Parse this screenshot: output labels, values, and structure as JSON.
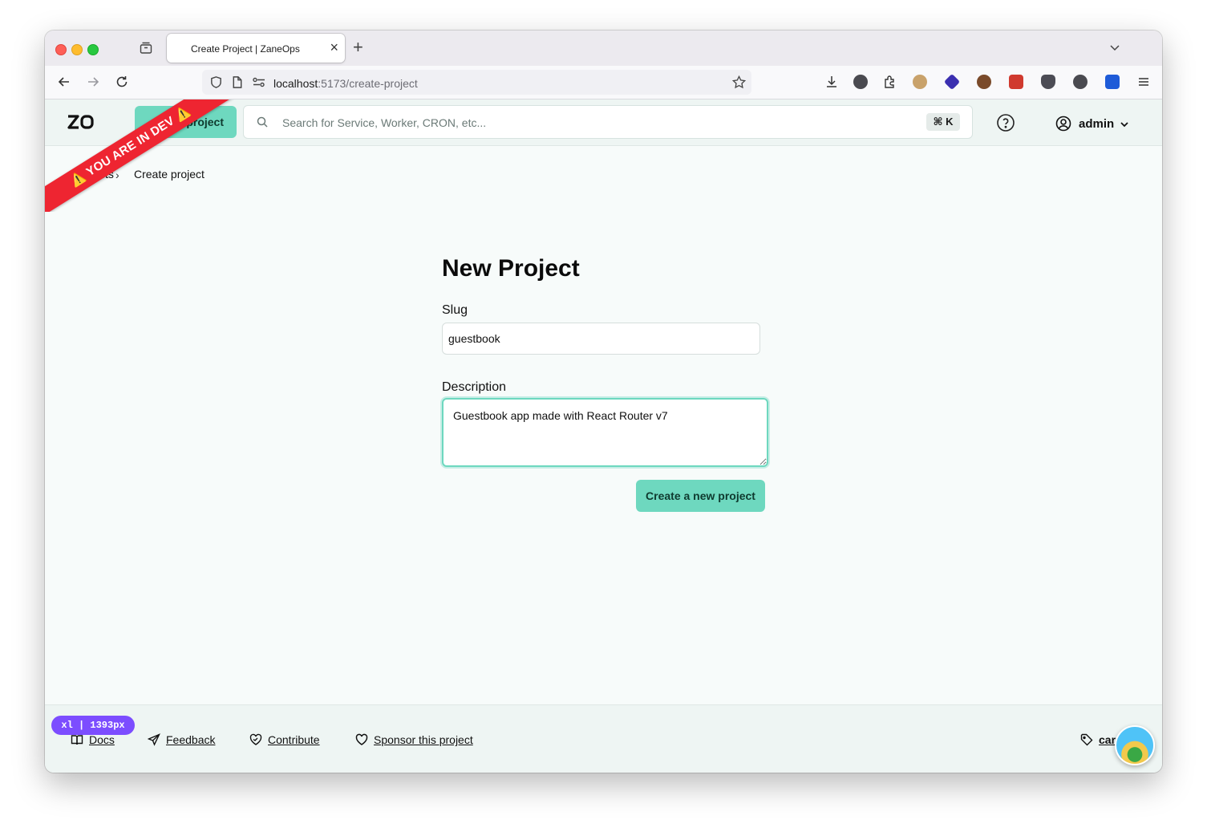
{
  "browser": {
    "tab_title": "Create Project | ZaneOps",
    "url_host": "localhost",
    "url_path": ":5173/create-project"
  },
  "header": {
    "logo_text": "ZO",
    "new_project_label": "project",
    "search_placeholder": "Search for Service, Worker, CRON, etc...",
    "search_shortcut": "⌘ K",
    "user_name": "admin"
  },
  "dev_banner": {
    "text": "⚠️ YOU ARE IN DEV ⚠️"
  },
  "breadcrumb": {
    "parent_visible": "cts",
    "separator": "›",
    "current": "Create project"
  },
  "form": {
    "title": "New Project",
    "slug_label": "Slug",
    "slug_value": "guestbook",
    "description_label": "Description",
    "description_value": "Guestbook app made with React Router v7",
    "submit_label": "Create a new project"
  },
  "footer": {
    "breakpoint_badge": "xl | 1393px",
    "docs_label": "Docs",
    "feedback_label": "Feedback",
    "contribute_label": "Contribute",
    "sponsor_label": "Sponsor this project",
    "version_label": "car"
  },
  "colors": {
    "accent": "#6ed8bf",
    "dev_banner": "#ee2531",
    "breakpoint_badge": "#7c4dff",
    "page_background": "#f7fbfa"
  },
  "icons": {
    "browser": [
      "tabs-icon",
      "close-icon",
      "plus-icon",
      "chevron-down-icon",
      "back-arrow-icon",
      "forward-arrow-icon",
      "reload-icon",
      "shield-icon",
      "page-icon",
      "permissions-icon",
      "star-icon",
      "download-icon",
      "menu-icon"
    ],
    "app": [
      "search-icon",
      "help-circle-icon",
      "user-circle-icon",
      "chevron-down-icon",
      "book-icon",
      "send-icon",
      "heart-handshake-icon",
      "heart-icon",
      "tag-icon"
    ]
  }
}
